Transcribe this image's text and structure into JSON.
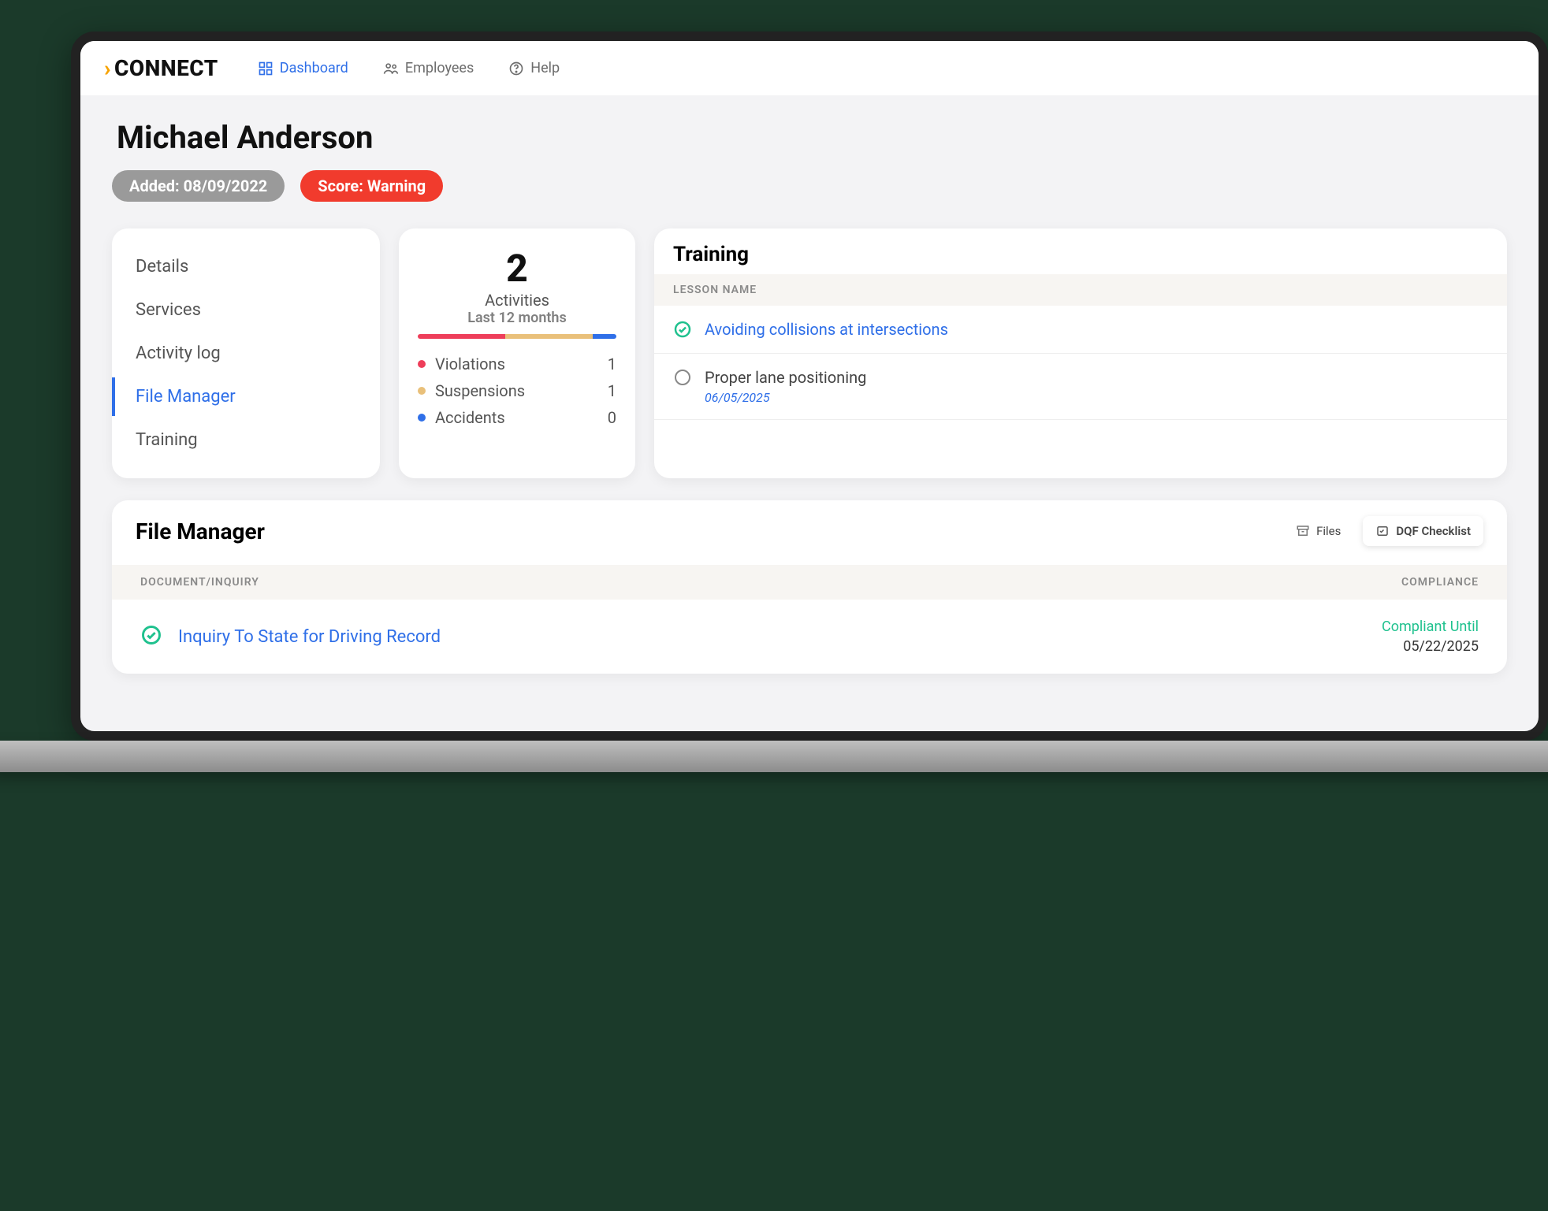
{
  "brand": "CONNECT",
  "nav": {
    "dashboard": "Dashboard",
    "employees": "Employees",
    "help": "Help"
  },
  "profile": {
    "name": "Michael Anderson",
    "added_label": "Added: 08/09/2022",
    "score_label": "Score: Warning"
  },
  "sidebar": {
    "items": [
      "Details",
      "Services",
      "Activity log",
      "File Manager",
      "Training"
    ],
    "active_index": 3
  },
  "activities": {
    "count": "2",
    "label": "Activities",
    "period": "Last 12 months",
    "series": [
      {
        "name": "Violations",
        "value": "1",
        "color": "#ee3e5a"
      },
      {
        "name": "Suspensions",
        "value": "1",
        "color": "#e9c07a"
      },
      {
        "name": "Accidents",
        "value": "0",
        "color": "#2f6fe8"
      }
    ],
    "bar_fractions": [
      0.44,
      0.44,
      0.12
    ]
  },
  "training": {
    "title": "Training",
    "col": "LESSON NAME",
    "rows": [
      {
        "done": true,
        "text": "Avoiding collisions at intersections",
        "date": ""
      },
      {
        "done": false,
        "text": "Proper lane positioning",
        "date": "06/05/2025"
      }
    ]
  },
  "file_manager": {
    "title": "File Manager",
    "tabs": {
      "files": "Files",
      "dqf": "DQF Checklist"
    },
    "col_doc": "DOCUMENT/INQUIRY",
    "col_comp": "COMPLIANCE",
    "row": {
      "doc": "Inquiry To State for Driving Record",
      "comp_label": "Compliant Until",
      "comp_date": "05/22/2025"
    }
  }
}
